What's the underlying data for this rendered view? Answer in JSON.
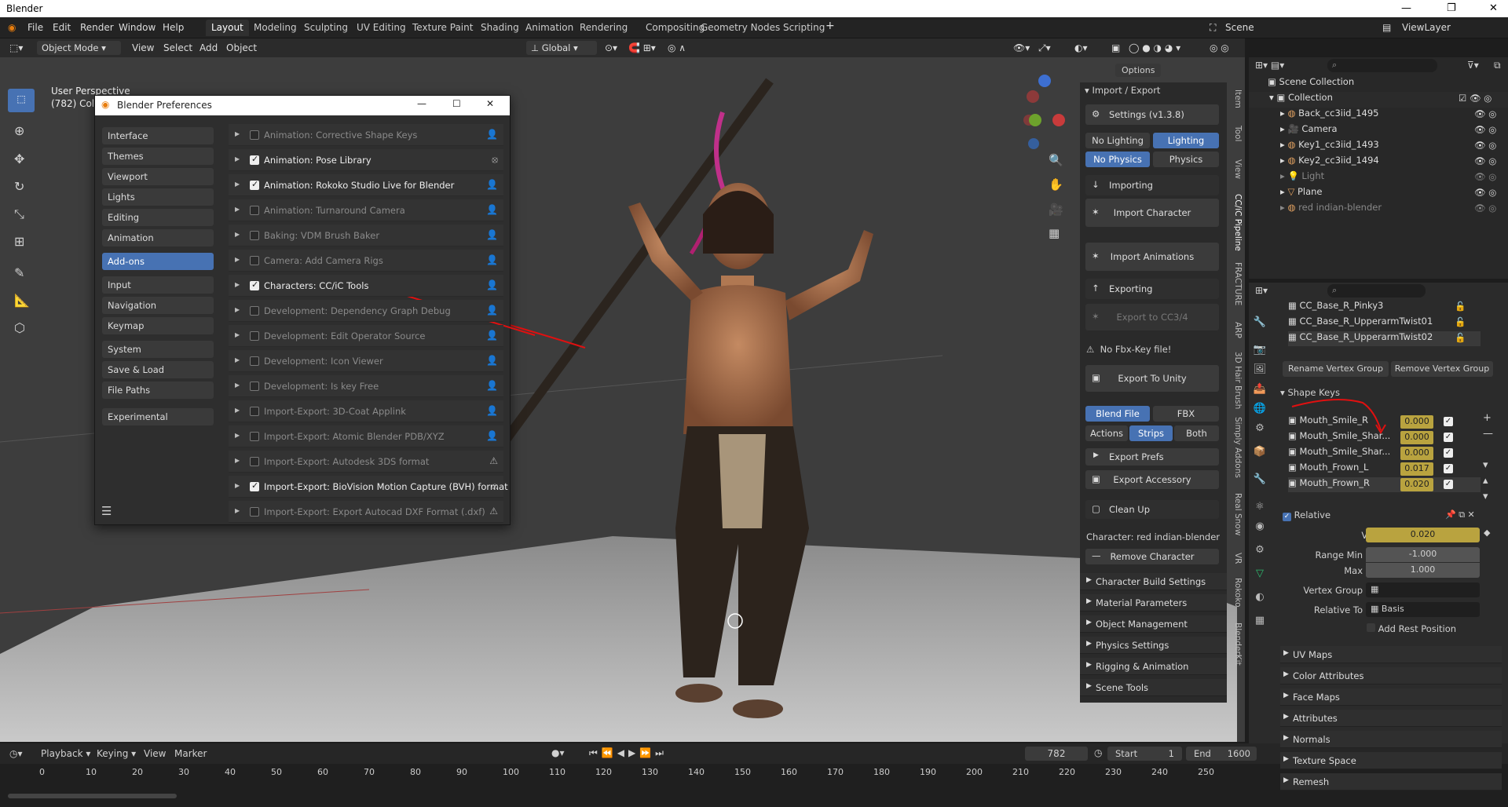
{
  "title": "Blender",
  "menu": [
    "File",
    "Edit",
    "Render",
    "Window",
    "Help"
  ],
  "workspaces": [
    "Layout",
    "Modeling",
    "Sculpting",
    "UV Editing",
    "Texture Paint",
    "Shading",
    "Animation",
    "Rendering",
    "Compositing",
    "Geometry Nodes",
    "Scripting"
  ],
  "scene": "Scene",
  "view_layer": "ViewLayer",
  "header": {
    "mode": "Object Mode",
    "view": "View",
    "select": "Select",
    "add": "Add",
    "object": "Object",
    "orientation": "Global",
    "options": "Options"
  },
  "viewport": {
    "perspective": "User Perspective",
    "collection_info": "(782) Collection"
  },
  "prefs": {
    "title": "Blender Preferences",
    "nav": [
      "Interface",
      "Themes",
      "Viewport",
      "Lights",
      "Editing",
      "Animation",
      "Add-ons",
      "Input",
      "Navigation",
      "Keymap",
      "System",
      "Save & Load",
      "File Paths",
      "Experimental"
    ],
    "active_nav": "Add-ons",
    "addons": [
      {
        "name": "Animation: Corrective Shape Keys",
        "enabled": false
      },
      {
        "name": "Animation: Pose Library",
        "enabled": true
      },
      {
        "name": "Animation: Rokoko Studio Live for Blender",
        "enabled": true
      },
      {
        "name": "Animation: Turnaround Camera",
        "enabled": false
      },
      {
        "name": "Baking: VDM Brush Baker",
        "enabled": false
      },
      {
        "name": "Camera: Add Camera Rigs",
        "enabled": false
      },
      {
        "name": "Characters: CC/iC Tools",
        "enabled": true
      },
      {
        "name": "Development: Dependency Graph Debug",
        "enabled": false
      },
      {
        "name": "Development: Edit Operator Source",
        "enabled": false
      },
      {
        "name": "Development: Icon Viewer",
        "enabled": false
      },
      {
        "name": "Development: Is key Free",
        "enabled": false
      },
      {
        "name": "Import-Export: 3D-Coat Applink",
        "enabled": false
      },
      {
        "name": "Import-Export: Atomic Blender PDB/XYZ",
        "enabled": false
      },
      {
        "name": "Import-Export: Autodesk 3DS format",
        "enabled": false
      },
      {
        "name": "Import-Export: BioVision Motion Capture (BVH) format",
        "enabled": true
      },
      {
        "name": "Import-Export: Export Autocad DXF Format (.dxf)",
        "enabled": false
      }
    ]
  },
  "npanel": {
    "header": "Import / Export",
    "settings": "Settings  (v1.3.8)",
    "no_lighting": "No Lighting",
    "lighting": "Lighting",
    "no_physics": "No Physics",
    "physics": "Physics",
    "importing": "Importing",
    "import_character": "Import Character",
    "import_animations": "Import Animations",
    "exporting": "Exporting",
    "export_cc": "Export to CC3/4",
    "no_fbx_key": "No Fbx-Key file!",
    "export_unity": "Export To Unity",
    "blend_file": "Blend File",
    "fbx": "FBX",
    "actions": "Actions",
    "strips": "Strips",
    "both": "Both",
    "export_prefs": "Export Prefs",
    "export_accessory": "Export Accessory",
    "clean_up": "Clean Up",
    "character": "Character: red indian-blender",
    "remove_character": "Remove Character",
    "sections": [
      "Character Build Settings",
      "Material Parameters",
      "Object Management",
      "Physics Settings",
      "Rigging & Animation",
      "Scene Tools"
    ],
    "tabs": [
      "Item",
      "Tool",
      "View",
      "CC/iC Pipeline",
      "FRACTURE",
      "ARP",
      "3D Hair Brush",
      "Simply Addons",
      "Real Snow",
      "VR",
      "Rokoko",
      "BlenderKit"
    ]
  },
  "outliner": {
    "scene_collection": "Scene Collection",
    "collection": "Collection",
    "items": [
      {
        "name": "Back_cc3iid_1495",
        "dim": false
      },
      {
        "name": "Camera",
        "dim": false
      },
      {
        "name": "Key1_cc3iid_1493",
        "dim": false
      },
      {
        "name": "Key2_cc3iid_1494",
        "dim": false
      },
      {
        "name": "Light",
        "dim": true
      },
      {
        "name": "Plane",
        "dim": false
      },
      {
        "name": "red indian-blender",
        "dim": true
      }
    ]
  },
  "props": {
    "vertex_groups": [
      "CC_Base_R_Pinky3",
      "CC_Base_R_UpperarmTwist01",
      "CC_Base_R_UpperarmTwist02"
    ],
    "rename_vg": "Rename Vertex Group",
    "remove_vg": "Remove Vertex Group",
    "shape_keys_title": "Shape Keys",
    "shape_keys": [
      {
        "name": "Mouth_Smile_R",
        "value": "0.000"
      },
      {
        "name": "Mouth_Smile_Shar...",
        "value": "0.000"
      },
      {
        "name": "Mouth_Smile_Shar...",
        "value": "0.000"
      },
      {
        "name": "Mouth_Frown_L",
        "value": "0.017"
      },
      {
        "name": "Mouth_Frown_R",
        "value": "0.020"
      }
    ],
    "relative": "Relative",
    "value_label": "Value",
    "value": "0.020",
    "range_min_label": "Range Min",
    "range_min": "-1.000",
    "max_label": "Max",
    "max": "1.000",
    "vertex_group_label": "Vertex Group",
    "relative_to_label": "Relative To",
    "relative_to": "Basis",
    "add_rest": "Add Rest Position",
    "sections": [
      "UV Maps",
      "Color Attributes",
      "Face Maps",
      "Attributes",
      "Normals",
      "Texture Space",
      "Remesh"
    ]
  },
  "timeline": {
    "playback": "Playback",
    "keying": "Keying",
    "view": "View",
    "marker": "Marker",
    "frame": "782",
    "start_label": "Start",
    "start": "1",
    "end_label": "End",
    "end": "1600",
    "ticks": [
      "0",
      "10",
      "20",
      "30",
      "40",
      "50",
      "60",
      "70",
      "80",
      "90",
      "100",
      "110",
      "120",
      "130",
      "140",
      "150",
      "160",
      "170",
      "180",
      "190",
      "200",
      "210",
      "220",
      "230",
      "240",
      "250"
    ]
  }
}
